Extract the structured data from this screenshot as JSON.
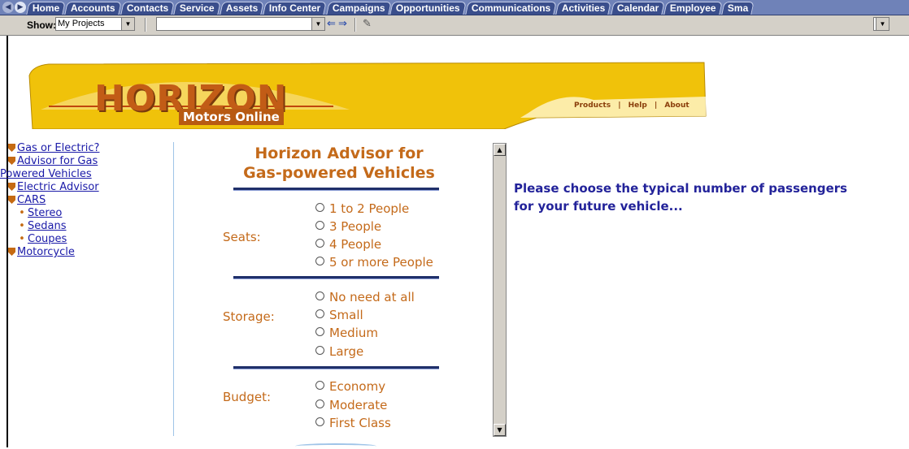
{
  "tabbar": {
    "tabs": [
      "Home",
      "Accounts",
      "Contacts",
      "Service",
      "Assets",
      "Info Center",
      "Campaigns",
      "Opportunities",
      "Communications",
      "Activities",
      "Calendar",
      "Employee",
      "Sma"
    ]
  },
  "toolbar": {
    "show_label": "Show:",
    "show_value": "My Projects"
  },
  "banner": {
    "logo": "HORIZON",
    "subtitle": "Motors Online",
    "links": [
      "Products",
      "Help",
      "About"
    ],
    "divider": "|"
  },
  "leftnav": {
    "items": [
      {
        "label": "Gas or Electric?",
        "type": "shield"
      },
      {
        "label": "Advisor for Gas",
        "type": "shield"
      },
      {
        "label": "Powered Vehicles",
        "type": "wrap"
      },
      {
        "label": "Electric Advisor",
        "type": "shield"
      },
      {
        "label": "CARS",
        "type": "shield"
      },
      {
        "label": "Stereo",
        "type": "bullet"
      },
      {
        "label": "Sedans",
        "type": "bullet"
      },
      {
        "label": "Coupes",
        "type": "bullet"
      },
      {
        "label": "Motorcycle",
        "type": "shield"
      }
    ]
  },
  "advisor": {
    "title_line1": "Horizon Advisor for",
    "title_line2": "Gas-powered Vehicles",
    "groups": [
      {
        "label": "Seats:",
        "options": [
          "1 to 2 People",
          "3 People",
          "4 People",
          "5 or more People"
        ]
      },
      {
        "label": "Storage:",
        "options": [
          "No need at all",
          "Small",
          "Medium",
          "Large"
        ]
      },
      {
        "label": "Budget:",
        "options": [
          "Economy",
          "Moderate",
          "First Class"
        ]
      }
    ]
  },
  "prompt": {
    "line1": "Please choose the typical number of passengers",
    "line2": "for your future vehicle..."
  }
}
